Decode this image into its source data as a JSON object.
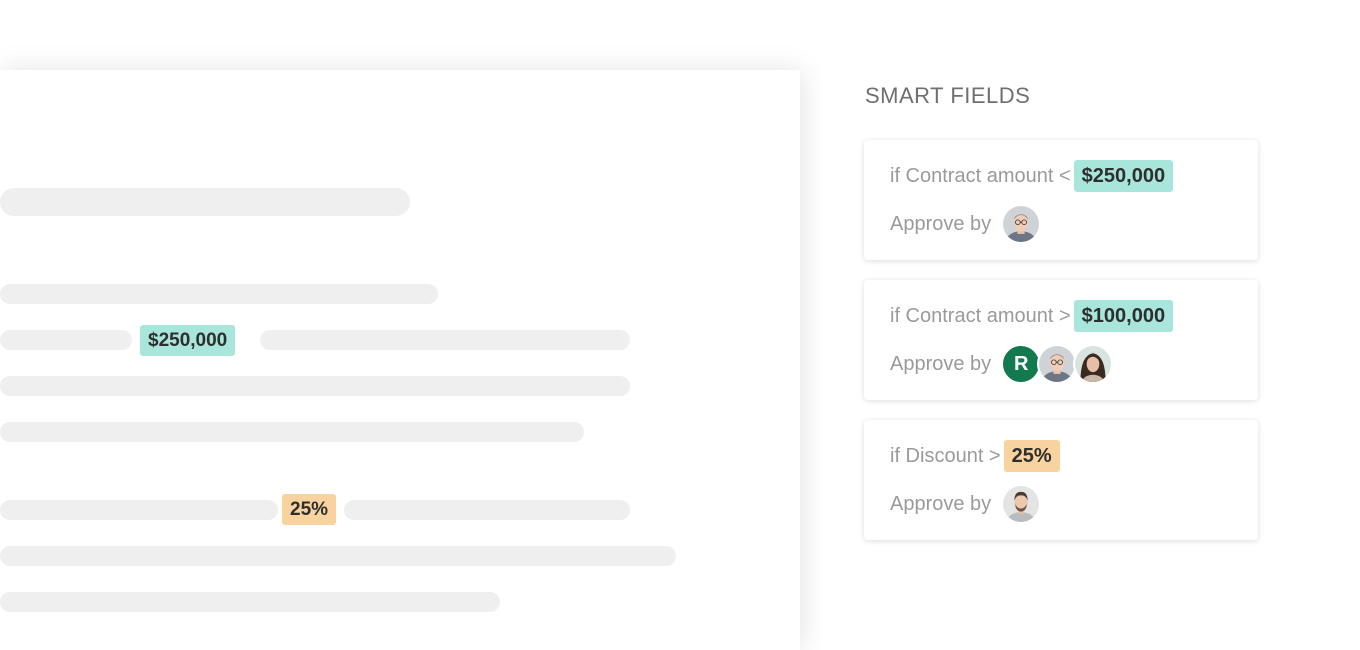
{
  "document": {
    "amount_tag": "$250,000",
    "discount_tag": "25%"
  },
  "panel": {
    "title": "SMART FIELDS",
    "cards": [
      {
        "condition_prefix": "if Contract amount <",
        "value": "$250,000",
        "value_color": "#a8e6dc",
        "approve_label": "Approve by",
        "approvers": [
          "man-glasses-photo"
        ]
      },
      {
        "condition_prefix": "if Contract amount >",
        "value": "$100,000",
        "value_color": "#a8e6dc",
        "approve_label": "Approve by",
        "approvers": [
          "initial-R",
          "man-glasses-photo",
          "woman-dark-hair-photo"
        ],
        "initial": "R"
      },
      {
        "condition_prefix": "if Discount >",
        "value": "25%",
        "value_color": "#f8d3a0",
        "approve_label": "Approve by",
        "approvers": [
          "man-beard-photo"
        ]
      }
    ]
  },
  "colors": {
    "teal_chip": "#a8e6dc",
    "peach_chip": "#f8d3a0",
    "placeholder_bar": "#efefef",
    "initial_avatar": "#137a4f"
  }
}
